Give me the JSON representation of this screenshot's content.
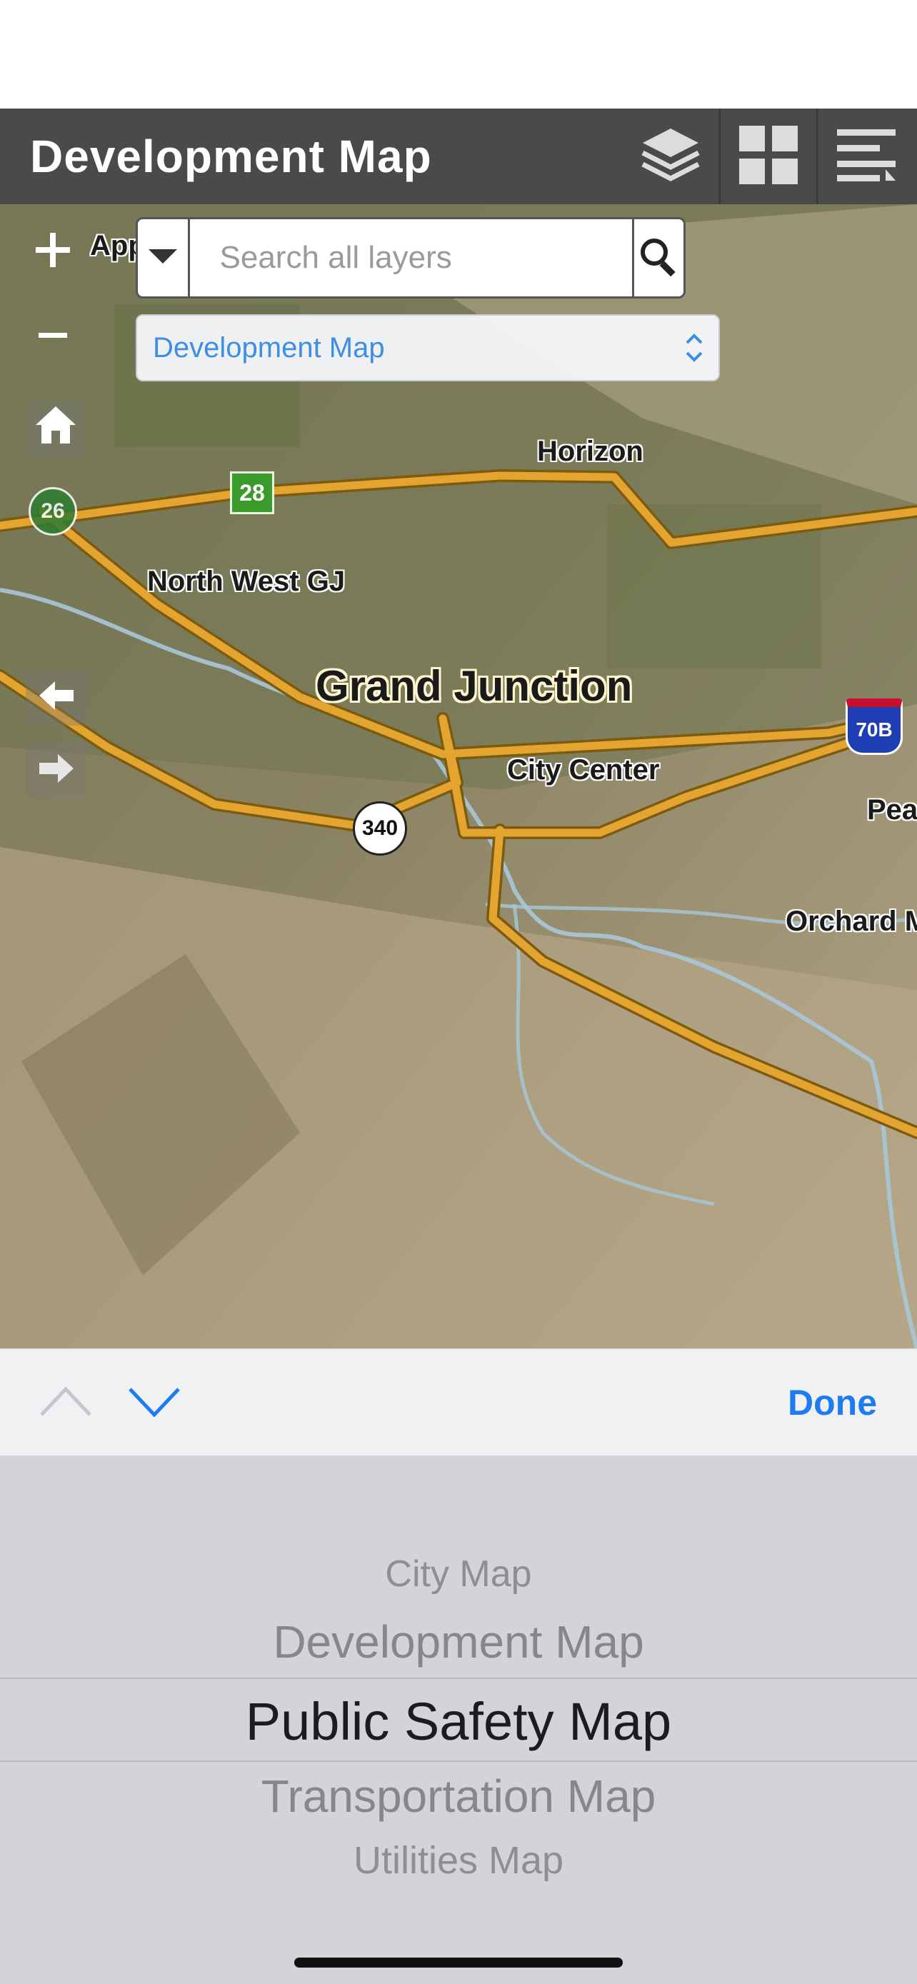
{
  "header": {
    "title": "Development Map"
  },
  "icons": {
    "layers": "layers-icon",
    "grid": "grid-icon",
    "menu": "menu-list-icon"
  },
  "search": {
    "placeholder": "Search all layers"
  },
  "map_selector": {
    "value": "Development Map"
  },
  "map_labels": {
    "horizon": "Horizon",
    "north_west": "North West GJ",
    "grand_junction": "Grand Junction",
    "city_center": "City Center",
    "orchard": "Orchard M",
    "pea": "Pea",
    "app": "App"
  },
  "shields": {
    "route_28": "28",
    "route_26": "26",
    "route_340": "340",
    "i70b": "70B"
  },
  "toolbar": {
    "done_label": "Done"
  },
  "picker": {
    "options": [
      "City Map",
      "Development Map",
      "Public Safety Map",
      "Transportation Map",
      "Utilities Map"
    ],
    "selected_index": 2
  }
}
